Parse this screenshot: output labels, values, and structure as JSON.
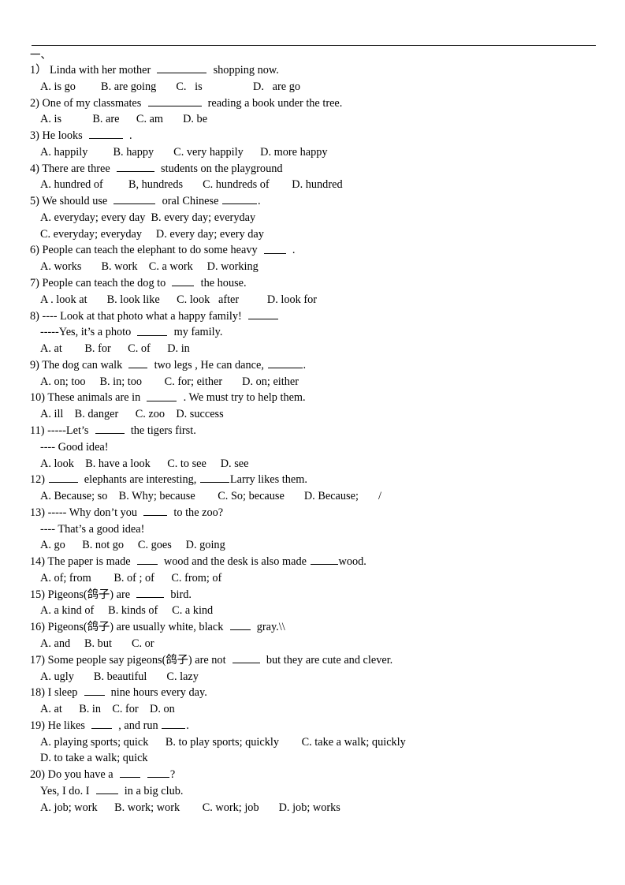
{
  "document": {
    "section_heading": "一、",
    "items": [
      {
        "number": "1）",
        "stem_pre": "Linda with her mother",
        "blank_w": 63,
        "stem_post": "shopping now.",
        "options": "A. is go         B. are going       C.   is                  D.   are go"
      },
      {
        "number": "2)",
        "stem_pre": "One of my classmates",
        "blank_w": 68,
        "stem_post": "reading a book under the tree.",
        "options": "A. is           B. are      C. am       D. be"
      },
      {
        "number": "3)",
        "stem_pre": "He looks",
        "blank_w": 43,
        "stem_post": ".",
        "options": "A. happily         B. happy       C. very happily      D. more happy"
      },
      {
        "number": "4)",
        "stem_pre": "There are three",
        "blank_w": 48,
        "stem_post": "students on the playground",
        "options": "A. hundred of         B, hundreds       C. hundreds of        D. hundred"
      },
      {
        "number": "5)",
        "stem_pre": "We should use",
        "blank_w": 53,
        "stem_mid": "oral Chinese",
        "blank2_w": 44,
        "stem_post": ".",
        "options": "A. everyday; every day  B. every day; everyday",
        "options2": "C. everyday; everyday     D. every day; every day"
      },
      {
        "number": "6)",
        "stem_pre": "People can teach the elephant to do some heavy",
        "blank_w": 28,
        "stem_post": ".",
        "options": "A. works       B. work    C. a work     D. working"
      },
      {
        "number": "7)",
        "stem_pre": "People can teach the dog to",
        "blank_w": 28,
        "stem_post": "the house.",
        "options": "A . look at       B. look like      C. look   after          D. look for"
      },
      {
        "number": "8)",
        "stem_pre": "---- Look at that photo what a happy family!",
        "continuation_pre": "-----Yes, it’s a photo",
        "blank_w": 38,
        "continuation_post": "my family.",
        "options": "A. at        B. for      C. of      D. in"
      },
      {
        "number": "9)",
        "stem_pre": "The dog can walk",
        "blank_w": 24,
        "stem_mid": "two legs , He can dance,",
        "blank2_w": 44,
        "stem_post": ".",
        "options": "A. on; too     B. in; too        C. for; either       D. on; either"
      },
      {
        "number": "10)",
        "stem_pre": "These animals are in",
        "blank_w": 38,
        "stem_post": ". We must try to help them.",
        "options": "A. ill    B. danger      C. zoo    D. success"
      },
      {
        "number": "11)",
        "stem_pre": "-----Let’s",
        "blank_w": 37,
        "stem_post": "the tigers first.",
        "continuation": "---- Good idea!",
        "options": "A. look    B. have a look      C. to see     D. see"
      },
      {
        "number": "12)",
        "stem_pre": "",
        "blank_w": 37,
        "stem_mid": "elephants are interesting,",
        "blank2_w": 37,
        "stem_post": "Larry likes them.",
        "options": "A. Because; so    B. Why; because        C. So; because       D. Because;       /"
      },
      {
        "number": "13)",
        "stem_pre": "----- Why don’t you",
        "blank_w": 30,
        "stem_post": "to the zoo?",
        "continuation": "---- That’s a good idea!",
        "options": "A. go      B. not go     C. goes     D. going"
      },
      {
        "number": "14)",
        "stem_pre": "The paper is made",
        "blank_w": 26,
        "stem_mid": "wood and the desk is also made",
        "blank2_w": 35,
        "stem_post": "wood.",
        "options": "A. of; from        B. of ; of      C. from; of"
      },
      {
        "number": "15)",
        "stem_pre": "Pigeons(鸽子) are",
        "blank_w": 35,
        "stem_post": "bird.",
        "options": "A. a kind of     B. kinds of     C. a kind"
      },
      {
        "number": "16)",
        "stem_pre": "Pigeons(鸽子) are usually white, black",
        "blank_w": 26,
        "stem_post": "gray.\\\\",
        "options": "A. and     B. but       C. or"
      },
      {
        "number": "17)",
        "stem_pre": "Some people say pigeons(鸽子) are not",
        "blank_w": 35,
        "stem_post": "but they are cute and clever.",
        "options": "A. ugly       B. beautiful       C. lazy"
      },
      {
        "number": "18)",
        "stem_pre": "I sleep",
        "blank_w": 26,
        "stem_post": "nine hours every day.",
        "options": "A. at      B. in    C. for    D. on"
      },
      {
        "number": "19)",
        "stem_pre": "He likes",
        "blank_w": 26,
        "stem_mid": ", and run",
        "blank2_w": 30,
        "stem_post": ".",
        "options": "A. playing sports; quick      B. to play sports; quickly        C. take a walk; quickly",
        "options2": "D. to take a walk; quick"
      },
      {
        "number": "20)",
        "stem_pre": "Do you have a",
        "blank_w": 26,
        "stem_post": "?",
        "continuation_pre": "Yes, I do. I",
        "blank2_w": 28,
        "continuation_post": "in a big club.",
        "options": "A. job; work      B. work; work        C. work; job       D. job; works"
      }
    ]
  }
}
